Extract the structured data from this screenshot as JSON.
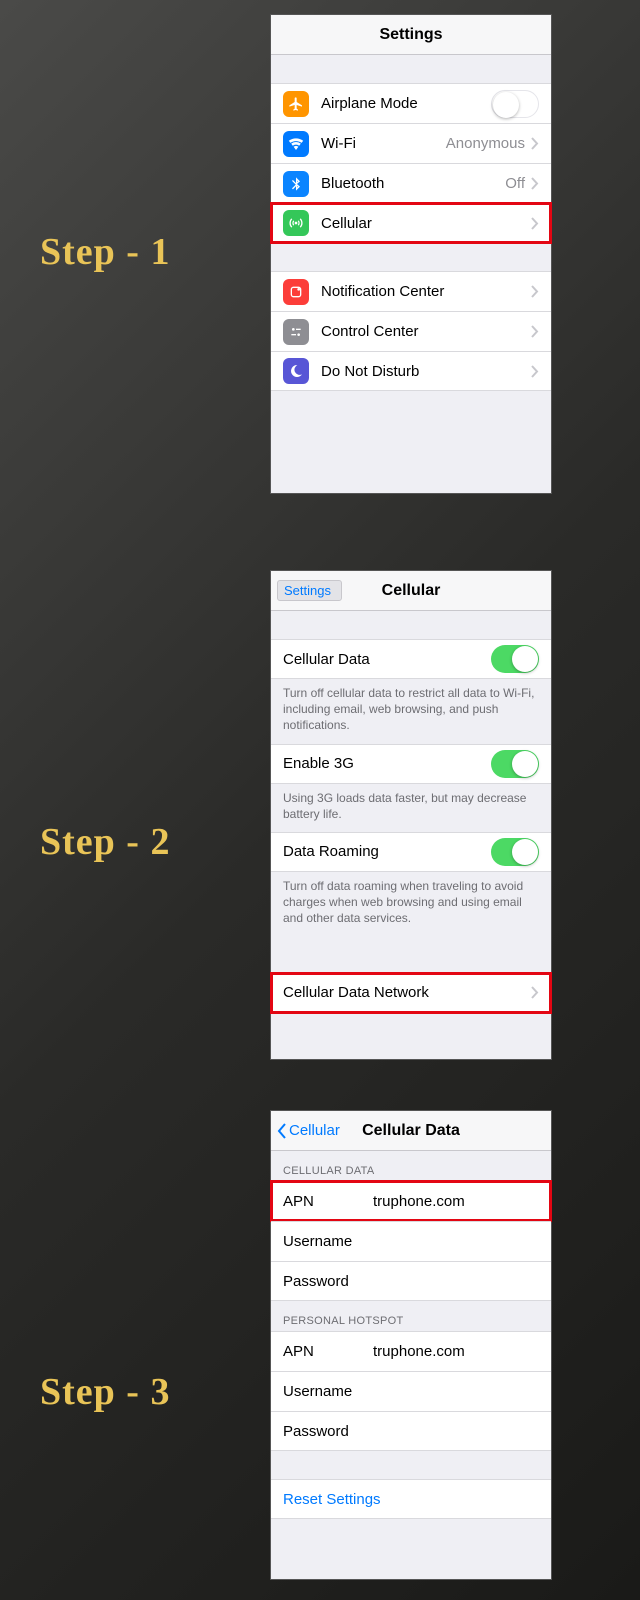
{
  "steps": {
    "s1": "Step - 1",
    "s2": "Step - 2",
    "s3": "Step - 3"
  },
  "screen1": {
    "title": "Settings",
    "rows": {
      "airplane": "Airplane Mode",
      "wifi": "Wi-Fi",
      "wifi_value": "Anonymous",
      "bluetooth": "Bluetooth",
      "bluetooth_value": "Off",
      "cellular": "Cellular",
      "notification": "Notification Center",
      "control": "Control Center",
      "dnd": "Do Not Disturb"
    }
  },
  "screen2": {
    "back": "Settings",
    "title": "Cellular",
    "cellular_data": "Cellular Data",
    "cellular_data_desc": "Turn off cellular data to restrict all data to Wi-Fi, including email, web browsing, and push notifications.",
    "enable_3g": "Enable 3G",
    "enable_3g_desc": "Using 3G loads data faster, but may decrease battery life.",
    "data_roaming": "Data Roaming",
    "data_roaming_desc": "Turn off data roaming when traveling to avoid charges when web browsing and using email and other data services.",
    "cdn": "Cellular Data Network"
  },
  "screen3": {
    "back": "Cellular",
    "title": "Cellular Data",
    "group1": "CELLULAR DATA",
    "group2": "PERSONAL HOTSPOT",
    "apn_label": "APN",
    "apn_value": "truphone.com",
    "username": "Username",
    "password": "Password",
    "reset": "Reset Settings"
  }
}
